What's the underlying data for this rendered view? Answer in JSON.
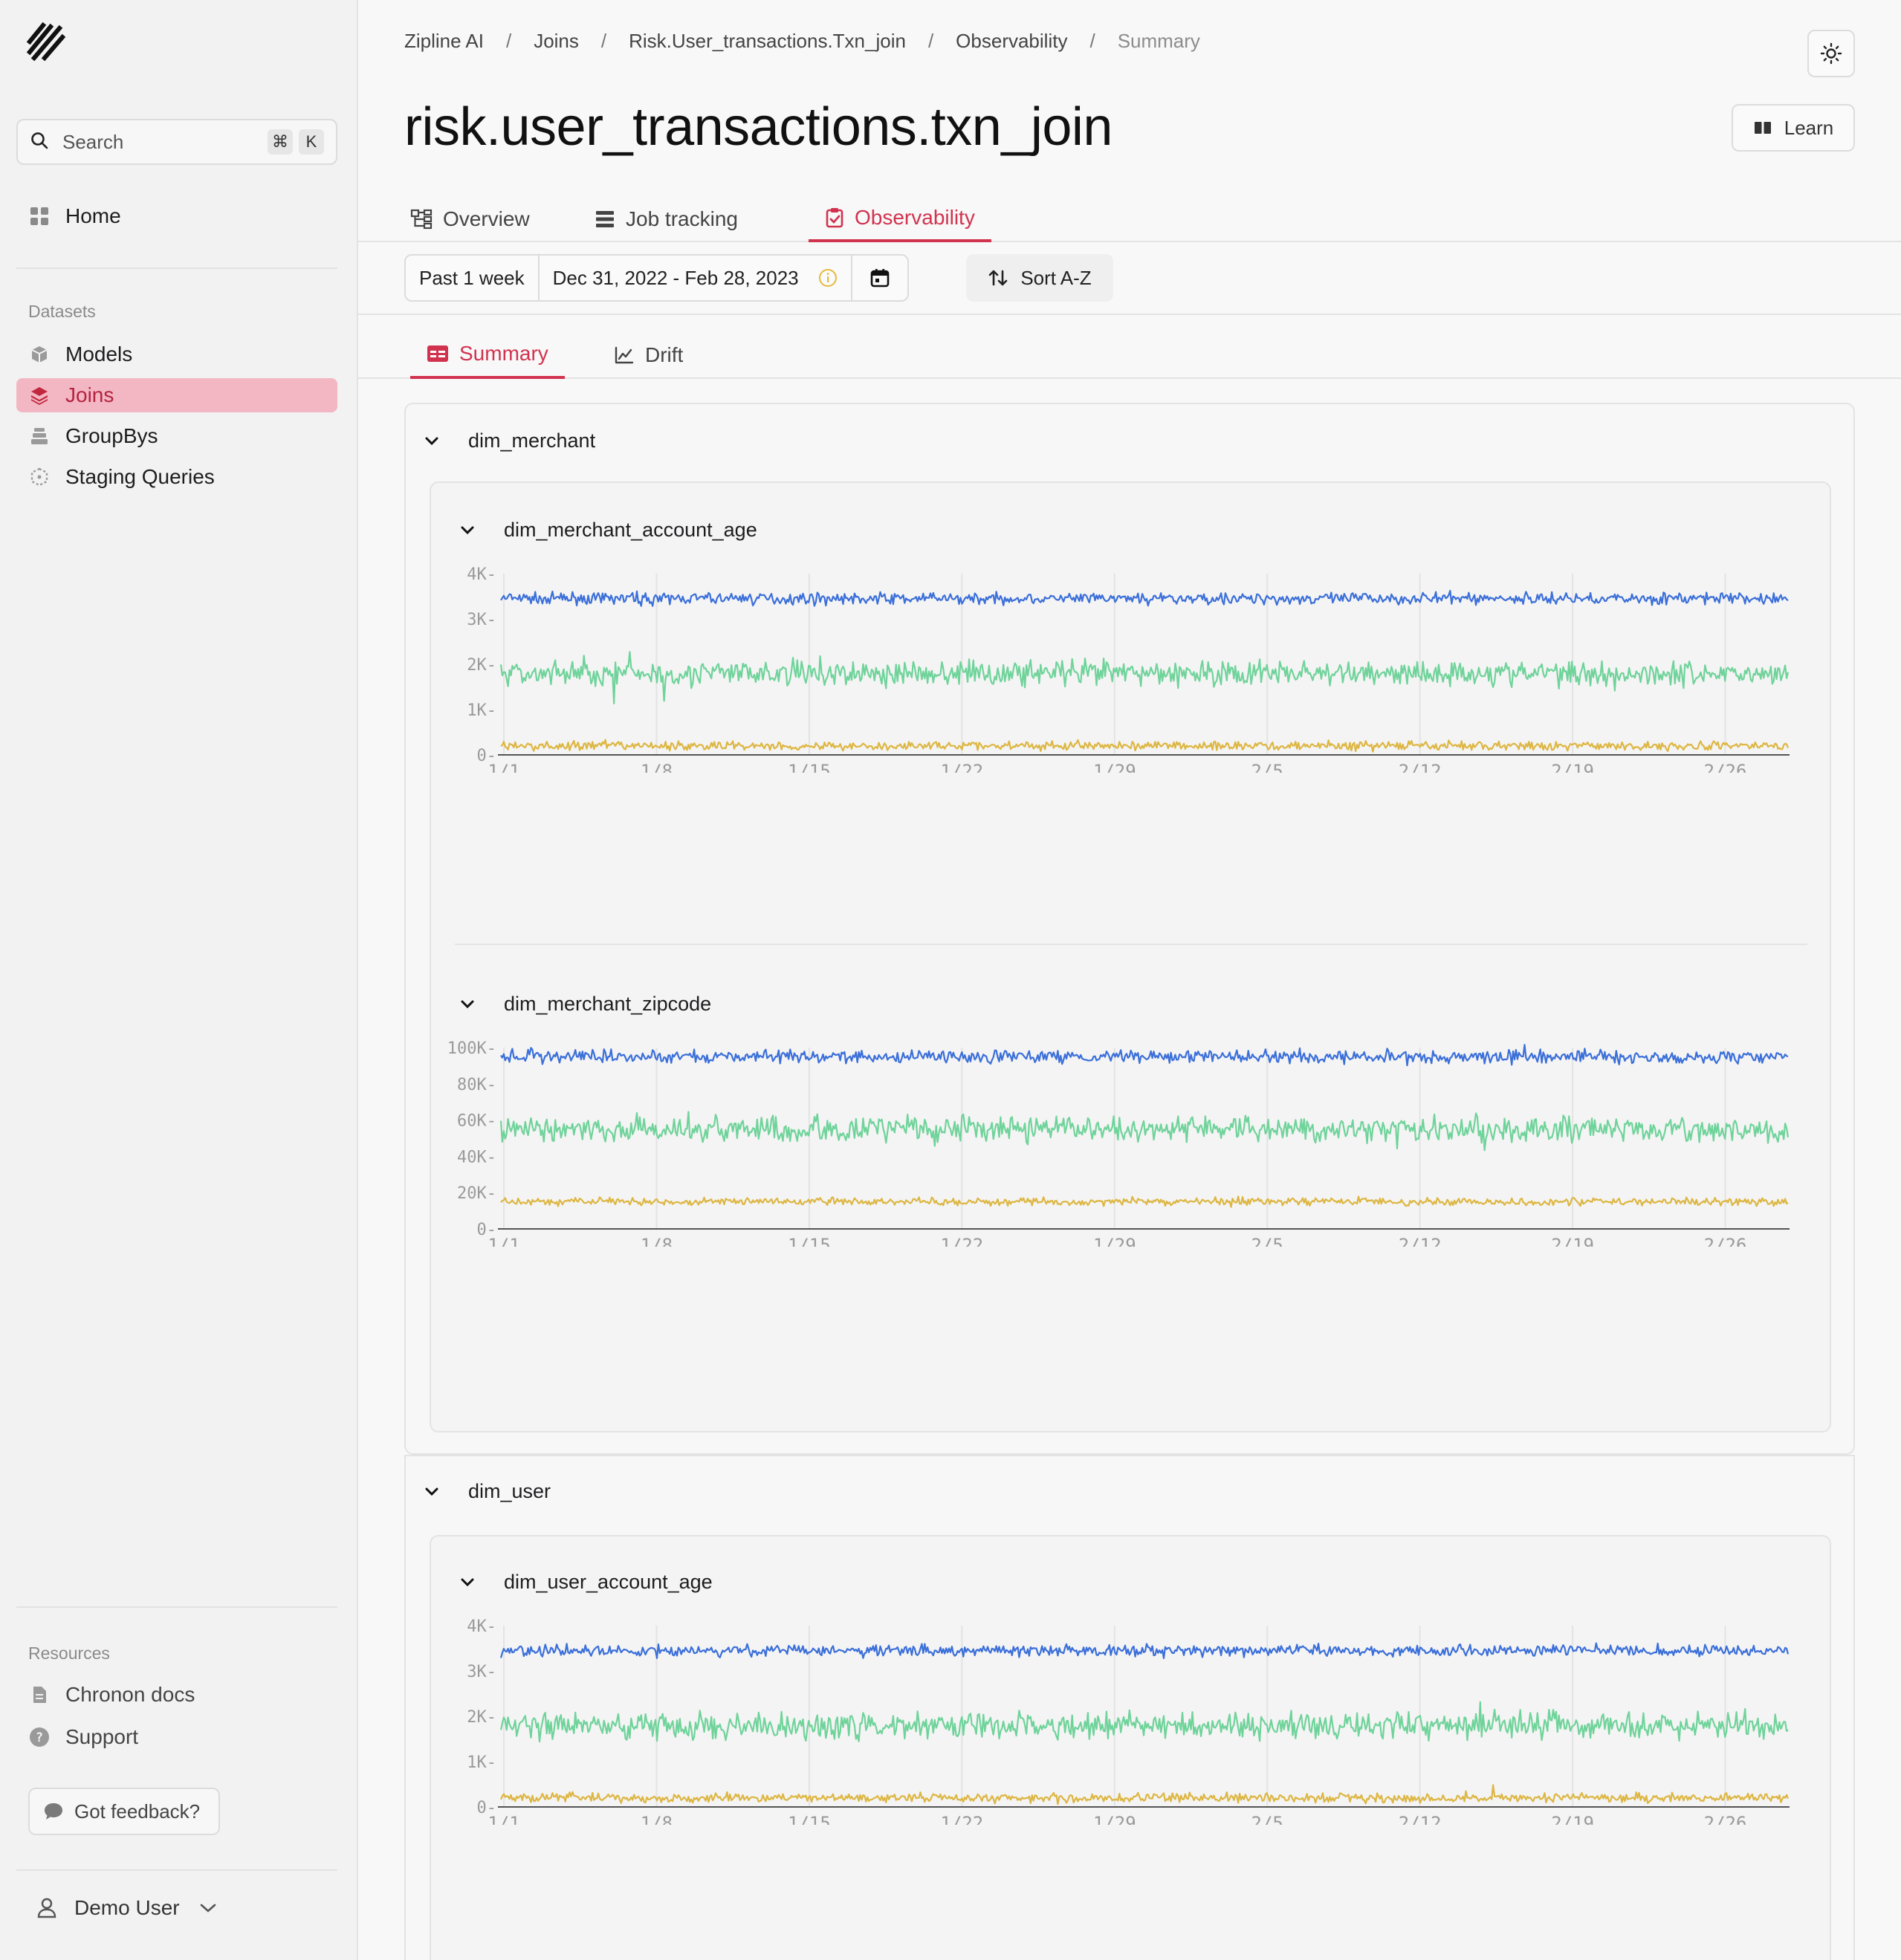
{
  "sidebar": {
    "search_label": "Search",
    "search_shortcut": [
      "⌘",
      "K"
    ],
    "home_label": "Home",
    "datasets_label": "Datasets",
    "datasets": [
      {
        "label": "Models",
        "icon": "cube-icon"
      },
      {
        "label": "Joins",
        "icon": "layers-icon",
        "active": true
      },
      {
        "label": "GroupBys",
        "icon": "stack-icon"
      },
      {
        "label": "Staging Queries",
        "icon": "dashed-cube-icon"
      }
    ],
    "resources_label": "Resources",
    "resources": [
      {
        "label": "Chronon docs",
        "icon": "document-icon"
      },
      {
        "label": "Support",
        "icon": "help-icon"
      }
    ],
    "feedback_label": "Got feedback?",
    "user_label": "Demo User"
  },
  "breadcrumb": [
    "Zipline AI",
    "Joins",
    "Risk.User_transactions.Txn_join",
    "Observability",
    "Summary"
  ],
  "page": {
    "title": "risk.user_transactions.txn_join",
    "learn_label": "Learn"
  },
  "tabs": [
    {
      "label": "Overview",
      "icon": "flowchart-icon"
    },
    {
      "label": "Job tracking",
      "icon": "list-icon"
    },
    {
      "label": "Observability",
      "icon": "clipboard-check-icon",
      "active": true
    }
  ],
  "toolbar": {
    "range_label": "Past 1 week",
    "date_range": "Dec 31, 2022 - Feb 28, 2023",
    "sort_label": "Sort A-Z"
  },
  "subtabs": [
    {
      "label": "Summary",
      "icon": "table-icon",
      "active": true
    },
    {
      "label": "Drift",
      "icon": "line-chart-icon"
    }
  ],
  "groups": [
    {
      "name": "dim_merchant",
      "features": [
        "dim_merchant_account_age",
        "dim_merchant_zipcode"
      ]
    },
    {
      "name": "dim_user",
      "features": [
        "dim_user_account_age"
      ]
    }
  ],
  "colors": {
    "accent": "#d1334f",
    "series_blue": "#3b6fd9",
    "series_green": "#6fd39a",
    "series_yellow": "#ddb642"
  },
  "chart_data": [
    {
      "type": "line",
      "title": "dim_merchant_account_age",
      "x_ticks": [
        "1/1",
        "1/8",
        "1/15",
        "1/22",
        "1/29",
        "2/5",
        "2/12",
        "2/19",
        "2/26"
      ],
      "y_ticks": [
        "0",
        "1K",
        "2K",
        "3K",
        "4K"
      ],
      "ylim": [
        0,
        4000
      ],
      "x_range": [
        "2023-01-01",
        "2023-02-28"
      ],
      "grid": true,
      "series": [
        {
          "color": "#3b6fd9",
          "mean": 3450,
          "noise": 90
        },
        {
          "color": "#6fd39a",
          "mean": 1800,
          "noise": 200
        },
        {
          "color": "#ddb642",
          "mean": 200,
          "noise": 70
        }
      ]
    },
    {
      "type": "line",
      "title": "dim_merchant_zipcode",
      "x_ticks": [
        "1/1",
        "1/8",
        "1/15",
        "1/22",
        "1/29",
        "2/5",
        "2/12",
        "2/19",
        "2/26"
      ],
      "y_ticks": [
        "0",
        "20K",
        "40K",
        "60K",
        "80K",
        "100K"
      ],
      "ylim": [
        0,
        100000
      ],
      "x_range": [
        "2023-01-01",
        "2023-02-28"
      ],
      "grid": true,
      "series": [
        {
          "color": "#3b6fd9",
          "mean": 95000,
          "noise": 2500
        },
        {
          "color": "#6fd39a",
          "mean": 55000,
          "noise": 5000
        },
        {
          "color": "#ddb642",
          "mean": 15000,
          "noise": 1500
        }
      ]
    },
    {
      "type": "line",
      "title": "dim_user_account_age",
      "x_ticks": [
        "1/1",
        "1/8",
        "1/15",
        "1/22",
        "1/29",
        "2/5",
        "2/12",
        "2/19",
        "2/26"
      ],
      "y_ticks": [
        "0",
        "1K",
        "2K",
        "3K",
        "4K"
      ],
      "ylim": [
        0,
        4000
      ],
      "x_range": [
        "2023-01-01",
        "2023-02-28"
      ],
      "grid": true,
      "series": [
        {
          "color": "#3b6fd9",
          "mean": 3450,
          "noise": 90
        },
        {
          "color": "#6fd39a",
          "mean": 1800,
          "noise": 200
        },
        {
          "color": "#ddb642",
          "mean": 200,
          "noise": 70
        }
      ]
    }
  ]
}
